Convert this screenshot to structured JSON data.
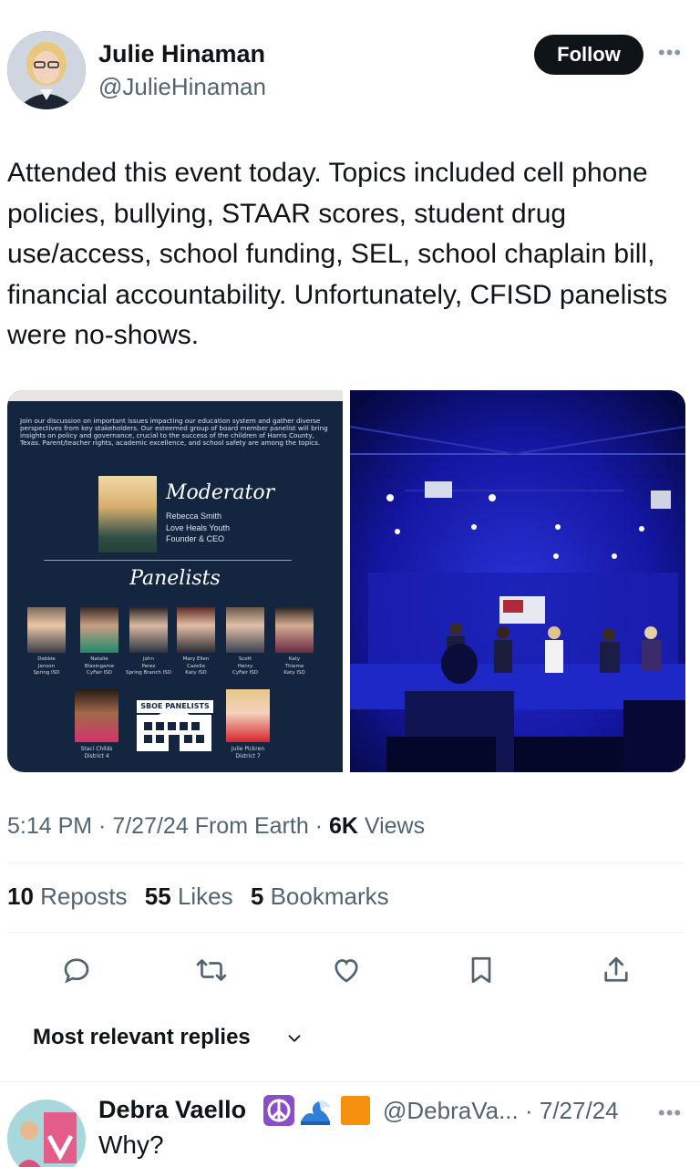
{
  "author": {
    "name": "Julie Hinaman",
    "handle": "@JulieHinaman",
    "follow_label": "Follow",
    "more_label": "•••"
  },
  "tweet": {
    "text": "Attended this event today. Topics included cell phone policies, bullying, STAAR scores, student drug use/access, school funding, SEL, school chaplain bill, financial accountability. Unfortunately, CFISD panelists were no-shows."
  },
  "flyer": {
    "intro": "Join our discussion on important issues impacting our education system and gather diverse perspectives from key stakeholders. Our esteemed group of board member panelist will bring insights on policy and governance, crucial to the success of the children of Harris County, Texas. Parent/teacher rights, academic excellence, and school safety are among the topics.",
    "moderator_title": "Moderator",
    "moderator_name": "Rebecca Smith",
    "moderator_org": "Love Heals Youth",
    "moderator_role": "Founder & CEO",
    "panelists_title": "Panelists",
    "panelists": [
      {
        "line1": "Debbie",
        "line2": "Jenson",
        "line3": "Spring ISD"
      },
      {
        "line1": "Natalie",
        "line2": "Blasingame",
        "line3": "CyFair ISD"
      },
      {
        "line1": "John",
        "line2": "Perez",
        "line3": "Spring Branch ISD"
      },
      {
        "line1": "Mary Ellen",
        "line2": "Cazelle",
        "line3": "Katy ISD"
      },
      {
        "line1": "Scott",
        "line2": "Henry",
        "line3": "CyFair ISD"
      },
      {
        "line1": "Katy",
        "line2": "Thieme",
        "line3": "Katy ISD"
      }
    ],
    "sboe_label": "SBOE PANELISTS",
    "sboe": [
      {
        "line1": "Staci Childs",
        "line2": "District 4"
      },
      {
        "line1": "Julie Pickren",
        "line2": "District 7"
      }
    ]
  },
  "meta": {
    "time": "5:14 PM",
    "sep1": " · ",
    "date": "7/27/24",
    "source": " From Earth",
    "sep2": " · ",
    "views_count": "6K",
    "views_label": " Views"
  },
  "stats": {
    "reposts_count": "10",
    "reposts_label": "Reposts",
    "likes_count": "55",
    "likes_label": "Likes",
    "bookmarks_count": "5",
    "bookmarks_label": "Bookmarks"
  },
  "replies": {
    "sort_label": "Most relevant replies"
  },
  "reply": {
    "name": "Debra Vaello",
    "handle": "@DebraVa... · 7/27/24",
    "text": "Why?",
    "more_label": "•••",
    "emojis": [
      "peace-symbol",
      "water-wave",
      "orange-square"
    ]
  },
  "colors": {
    "text_primary": "#0f1419",
    "text_secondary": "#536471",
    "follow_bg": "#0f1419",
    "flyer_bg": "#14253f",
    "stage_blue": "#0b0d6e"
  }
}
